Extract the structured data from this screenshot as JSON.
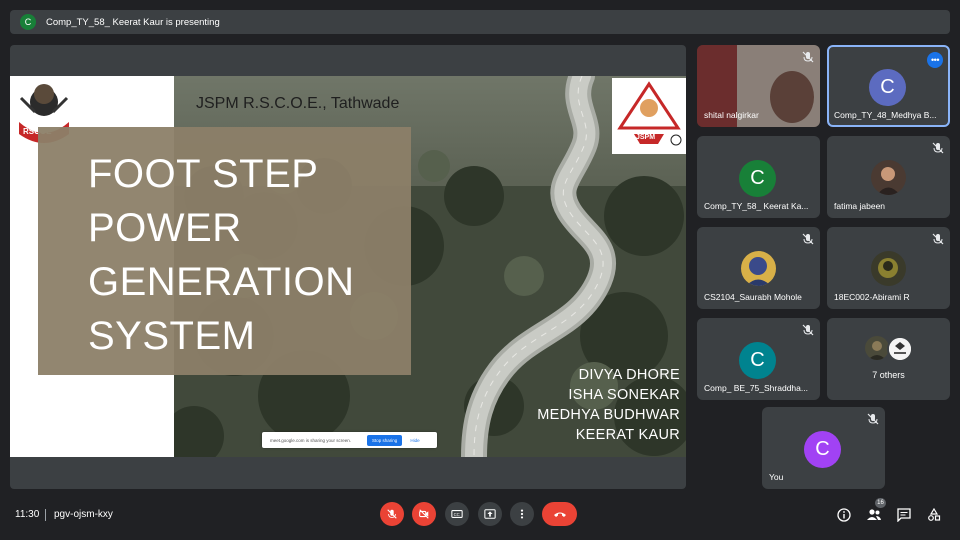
{
  "banner": {
    "avatar_letter": "C",
    "text": "Comp_TY_58_ Keerat Kaur is presenting"
  },
  "slide": {
    "college": "JSPM R.S.C.O.E., Tathwade",
    "title_lines": [
      "FOOT STEP",
      "POWER",
      "GENERATION",
      "SYSTEM"
    ],
    "names": [
      "DIVYA DHORE",
      "ISHA SONEKAR",
      "MEDHYA BUDHWAR",
      "KEERAT KAUR"
    ],
    "logo_left_text": "RSCOE",
    "logo_right_text": "JSPM",
    "share_text": "meet.google.com is sharing your screen.",
    "stop_label": "Stop sharing",
    "hide_label": "Hide"
  },
  "participants": [
    {
      "name": "shital nalgirkar",
      "type": "video",
      "muted": true
    },
    {
      "name": "Comp_TY_48_Medhya B...",
      "type": "letter",
      "letter": "C",
      "color": "#5c6bc0",
      "active": true
    },
    {
      "name": "Comp_TY_58_ Keerat Ka...",
      "type": "letter",
      "letter": "C",
      "color": "#188038",
      "muted": false
    },
    {
      "name": "fatima jabeen",
      "type": "photo",
      "muted": true
    },
    {
      "name": "CS2104_Saurabh Mohole",
      "type": "photo",
      "muted": true
    },
    {
      "name": "18EC002-Abirami R",
      "type": "photo",
      "muted": true
    },
    {
      "name": "Comp_ BE_75_Shraddha...",
      "type": "letter",
      "letter": "C",
      "color": "#00838f",
      "muted": true
    },
    {
      "name": "7 others",
      "type": "others"
    },
    {
      "name": "You",
      "type": "letter",
      "letter": "C",
      "color": "#a142f4",
      "muted": true
    }
  ],
  "bottom": {
    "time": "11:30",
    "meeting_code": "pgv-ojsm-kxy",
    "people_count": "16"
  },
  "colors": {
    "background": "#202124",
    "tile": "#3c4043",
    "danger": "#ea4335",
    "accent": "#1a73e8"
  }
}
